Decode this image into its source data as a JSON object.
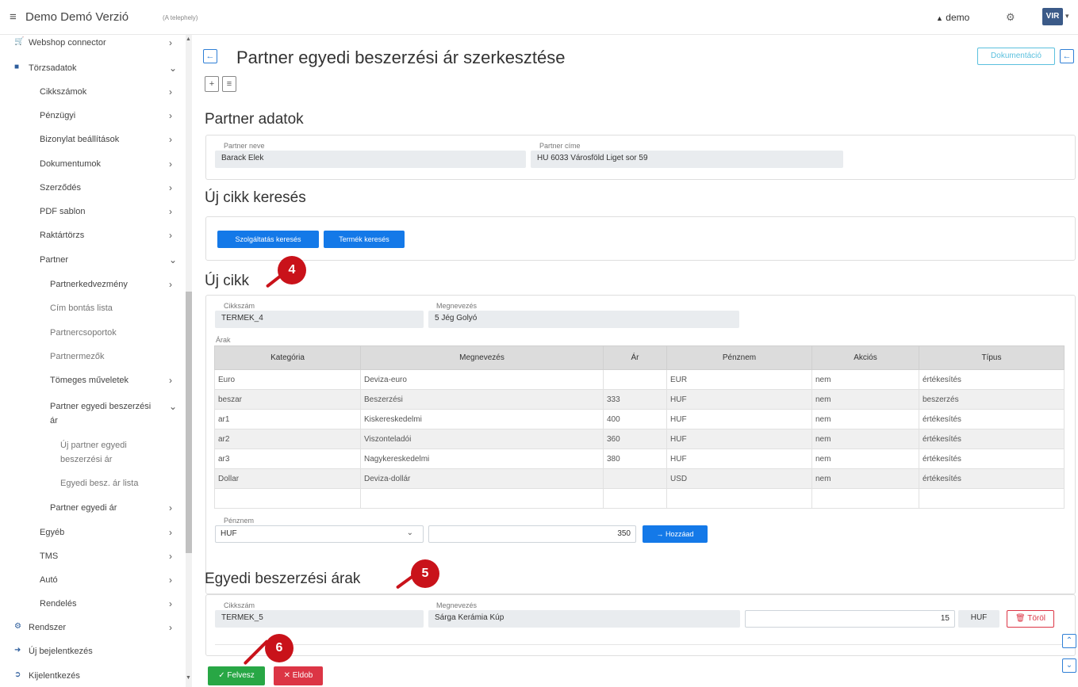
{
  "topbar": {
    "menu_icon": "≡",
    "app_title": "Demo Demó Verzió",
    "site": "(A telephely)",
    "user": "demo",
    "user_icon": "▲",
    "gear_icon": "⚙",
    "logo_text": "VIR"
  },
  "sidebar": {
    "items": [
      {
        "label": "Webshop connector",
        "chev": "›"
      },
      {
        "label": "Törzsadatok",
        "chev": "⌄"
      },
      {
        "label": "Cikkszámok",
        "chev": "›"
      },
      {
        "label": "Pénzügyi",
        "chev": "›"
      },
      {
        "label": "Bizonylat beállítások",
        "chev": "›"
      },
      {
        "label": "Dokumentumok",
        "chev": "›"
      },
      {
        "label": "Szerződés",
        "chev": "›"
      },
      {
        "label": "PDF sablon",
        "chev": "›"
      },
      {
        "label": "Raktártörzs",
        "chev": "›"
      },
      {
        "label": "Partner",
        "chev": "⌄"
      },
      {
        "label": "Partnerkedvezmény",
        "chev": "›"
      },
      {
        "label": "Cím bontás lista",
        "chev": ""
      },
      {
        "label": "Partnercsoportok",
        "chev": ""
      },
      {
        "label": "Partnermezők",
        "chev": ""
      },
      {
        "label": "Tömeges műveletek",
        "chev": "›"
      },
      {
        "label": "Partner egyedi beszerzési",
        "chev": "⌄"
      },
      {
        "label": "ár",
        "chev": ""
      },
      {
        "label": "Új partner egyedi",
        "chev": ""
      },
      {
        "label": "beszerzési ár",
        "chev": ""
      },
      {
        "label": "Egyedi besz. ár lista",
        "chev": ""
      },
      {
        "label": "Partner egyedi ár",
        "chev": "›"
      },
      {
        "label": "Egyéb",
        "chev": "›"
      },
      {
        "label": "TMS",
        "chev": "›"
      },
      {
        "label": "Autó",
        "chev": "›"
      },
      {
        "label": "Rendelés",
        "chev": "›"
      },
      {
        "label": "Rendszer",
        "chev": "›"
      },
      {
        "label": "Új bejelentkezés",
        "chev": ""
      },
      {
        "label": "Kijelentkezés",
        "chev": ""
      }
    ]
  },
  "page": {
    "title": "Partner egyedi beszerzési ár szerkesztése",
    "back_icon": "←",
    "doc_button": "Dokumentáció",
    "plus_icon": "+",
    "list_icon": "≡"
  },
  "partner": {
    "section_title": "Partner adatok",
    "name_label": "Partner neve",
    "name_value": "Barack Elek",
    "address_label": "Partner címe",
    "address_value": "HU 6033 Városföld Liget sor 59"
  },
  "search": {
    "section_title": "Új cikk keresés",
    "service_button": "Szolgáltatás keresés",
    "product_button": "Termék keresés"
  },
  "new_item": {
    "section_title": "Új cikk",
    "sku_label": "Cikkszám",
    "sku_value": "TERMEK_4",
    "name_label": "Megnevezés",
    "name_value": "5 Jég Golyó",
    "prices_label": "Árak",
    "headers": [
      "Kategória",
      "Megnevezés",
      "Ár",
      "Pénznem",
      "Akciós",
      "Típus"
    ],
    "rows": [
      [
        "Euro",
        "Deviza-euro",
        "",
        "EUR",
        "nem",
        "értékesítés"
      ],
      [
        "beszar",
        "Beszerzési",
        "333",
        "HUF",
        "nem",
        "beszerzés"
      ],
      [
        "ar1",
        "Kiskereskedelmi",
        "400",
        "HUF",
        "nem",
        "értékesítés"
      ],
      [
        "ar2",
        "Viszonteladói",
        "360",
        "HUF",
        "nem",
        "értékesítés"
      ],
      [
        "ar3",
        "Nagykereskedelmi",
        "380",
        "HUF",
        "nem",
        "értékesítés"
      ],
      [
        "Dollar",
        "Deviza-dollár",
        "",
        "USD",
        "nem",
        "értékesítés"
      ],
      [
        "",
        "",
        "",
        "",
        "",
        ""
      ]
    ],
    "currency_label": "Pénznem",
    "currency_value": "HUF",
    "price_value": "350",
    "add_button": "→ Hozzáad"
  },
  "custom_prices": {
    "section_title": "Egyedi beszerzési árak",
    "sku_label": "Cikkszám",
    "sku_value": "TERMEK_5",
    "name_label": "Megnevezés",
    "name_value": "Sárga Kerámia Kúp",
    "price_value": "15",
    "currency": "HUF",
    "delete_button": "🗑 Töröl"
  },
  "footer": {
    "save_button": "✓ Felvesz",
    "discard_button": "✕ Eldob"
  },
  "annotations": {
    "a4": "4",
    "a5": "5",
    "a6": "6"
  },
  "colors": {
    "primary": "#1479e8",
    "success": "#28a745",
    "danger": "#dc3545",
    "annotation": "#c9121a"
  }
}
